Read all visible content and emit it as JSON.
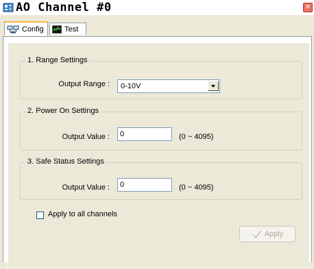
{
  "window": {
    "title": "AO Channel #0",
    "close_glyph": "✕"
  },
  "tabs": [
    {
      "label": "Config",
      "icon": "network-icon",
      "active": true
    },
    {
      "label": "Test",
      "icon": "chart-icon",
      "active": false
    }
  ],
  "range_settings": {
    "legend": "1. Range Settings",
    "label": "Output Range :",
    "value": "0-10V"
  },
  "power_on": {
    "legend": "2. Power On Settings",
    "label": "Output Value :",
    "value": "0",
    "range": "(0 ~ 4095)"
  },
  "safe_status": {
    "legend": "3. Safe Status Settings",
    "label": "Output Value :",
    "value": "0",
    "range": "(0 ~ 4095)"
  },
  "apply_all": {
    "label": "Apply to all channels",
    "checked": false
  },
  "apply_button": {
    "label": "Apply",
    "enabled": false
  },
  "colors": {
    "tab_highlight": "#f7b93a",
    "field_border": "#7f9db9",
    "panel_bg": "#ece9d8"
  }
}
